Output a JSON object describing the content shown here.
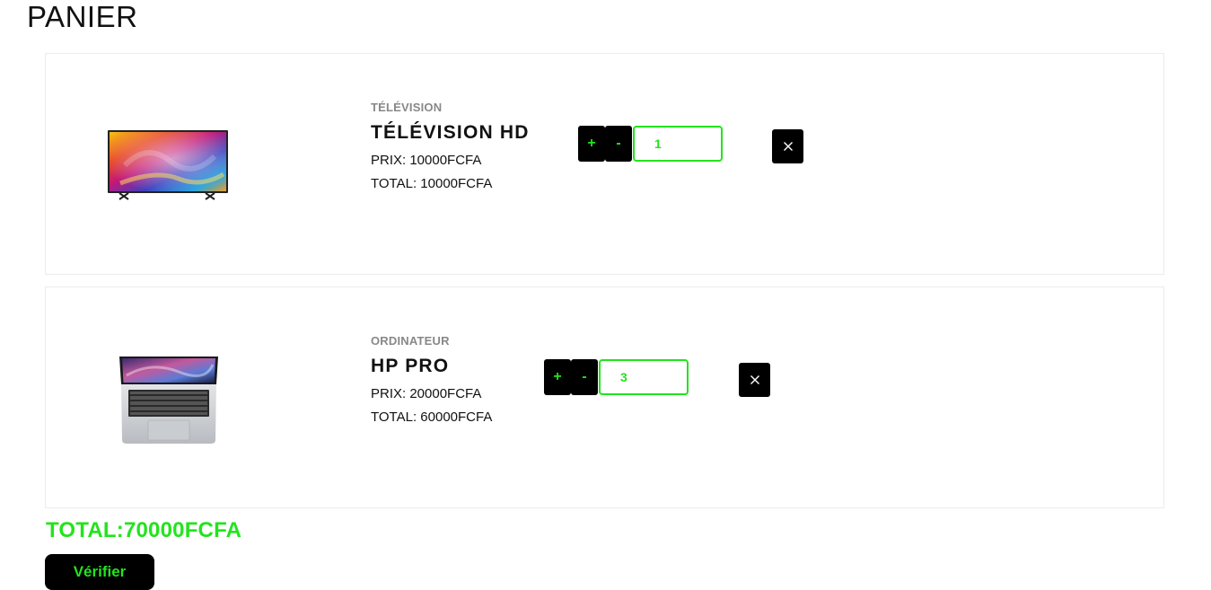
{
  "page_title": "PANIER",
  "accent_color": "#22e41c",
  "items": [
    {
      "category": "TÉLÉVISION",
      "name": "TÉLÉVISION HD",
      "price": "PRIX: 10000FCFA",
      "total": "TOTAL: 10000FCFA",
      "quantity": "1",
      "plus_label": "+",
      "minus_label": "-",
      "image_icon": "television-image"
    },
    {
      "category": "ORDINATEUR",
      "name": "HP PRO",
      "price": "PRIX: 20000FCFA",
      "total": "TOTAL: 60000FCFA",
      "quantity": "3",
      "plus_label": "+",
      "minus_label": "-",
      "image_icon": "laptop-image"
    }
  ],
  "grand_total": "TOTAL:70000FCFA",
  "verify_label": "Vérifier"
}
